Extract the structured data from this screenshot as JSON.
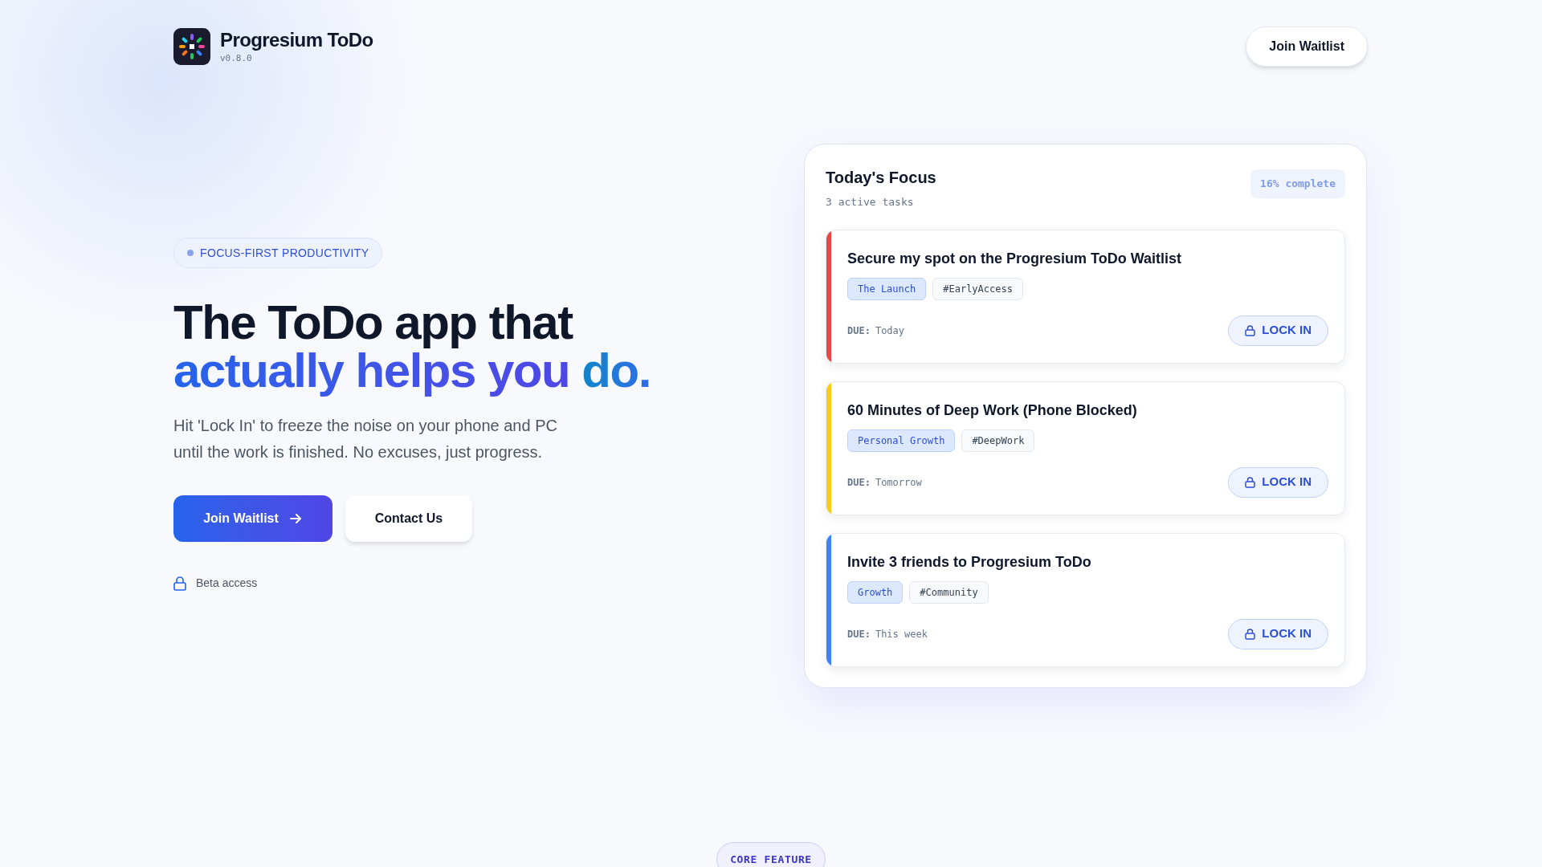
{
  "brand": {
    "name": "Progresium ToDo",
    "version": "v0.8.0"
  },
  "nav": {
    "button": "Join Waitlist"
  },
  "hero": {
    "badge": "FOCUS-FIRST PRODUCTIVITY",
    "headline": "The ToDo app that",
    "highlight": [
      {
        "text": "actually helps you ",
        "kind": "violet"
      },
      {
        "text": "do.",
        "kind": "cyan"
      }
    ],
    "lines": [
      "Hit 'Lock In' to freeze the noise on your phone and PC",
      "until the work is finished. No excuses, just progress."
    ],
    "primary_button": "Join Waitlist",
    "secondary_button": "Contact Us",
    "note": "Beta access"
  },
  "focus": {
    "title": "Today's Focus",
    "subtitle": "3 active tasks",
    "progress": "16% complete",
    "tasks": [
      {
        "title": "Secure my spot on the Progresium ToDo Waitlist",
        "color": "#ef4444",
        "tags": [
          {
            "text": "The Launch",
            "kind": "category"
          },
          {
            "text": "#EarlyAccess",
            "kind": "hashtag"
          }
        ],
        "due_label": "DUE:",
        "due": "Today",
        "button": "LOCK IN"
      },
      {
        "title": "60 Minutes of Deep Work (Phone Blocked)",
        "color": "#facc15",
        "tags": [
          {
            "text": "Personal Growth",
            "kind": "category"
          },
          {
            "text": "#DeepWork",
            "kind": "hashtag"
          }
        ],
        "due_label": "DUE:",
        "due": "Tomorrow",
        "button": "LOCK IN"
      },
      {
        "title": "Invite 3 friends to Progresium ToDo",
        "color": "#3b82f6",
        "tags": [
          {
            "text": "Growth",
            "kind": "category"
          },
          {
            "text": "#Community",
            "kind": "hashtag"
          }
        ],
        "due_label": "DUE:",
        "due": "This week",
        "button": "LOCK IN"
      }
    ]
  },
  "section_badge": "CORE FEATURE"
}
